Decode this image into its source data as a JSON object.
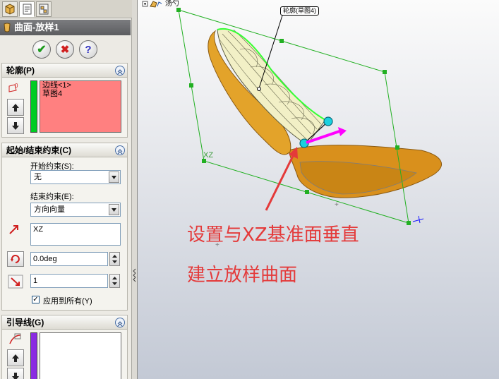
{
  "panel": {
    "title": "曲面-放样1",
    "tabs": [
      "feature-manager-icon",
      "property-manager-icon",
      "configuration-manager-icon"
    ],
    "actions": {
      "ok": "✔",
      "cancel": "✖",
      "help": "?"
    },
    "profiles": {
      "header": "轮廓(P)",
      "items": [
        "边线<1>",
        "草图4"
      ],
      "list_color": "#ff8080",
      "bar_color": "#00cc22"
    },
    "constraints": {
      "header": "起始/结束约束(C)",
      "start_label": "开始约束(S):",
      "start_value": "无",
      "end_label": "结束约束(E):",
      "end_value": "方向向量",
      "direction_value": "XZ",
      "angle_value": "0.0deg",
      "length_value": "1",
      "apply_all_label": "应用到所有(Y)",
      "apply_all_checked": true
    },
    "guides": {
      "header": "引导线(G)",
      "bar_color": "#8a2be2"
    }
  },
  "viewport": {
    "tree_node": "汤勺",
    "callout": "轮廓(草图4)",
    "plane_label": "XZ",
    "note_line1": "设置与XZ基准面垂直",
    "note_line2": "建立放样曲面",
    "colors": {
      "note": "#e43a3a",
      "plane": "#22b022",
      "surface": "#e09a20",
      "selection": "#f0f0c0",
      "vector": "#ff00ff"
    }
  }
}
